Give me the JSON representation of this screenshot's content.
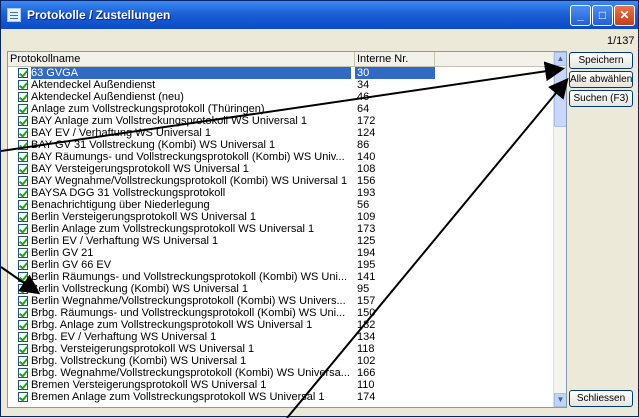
{
  "window": {
    "title": "Protokolle / Zustellungen",
    "counter": "1/137"
  },
  "columns": {
    "name": "Protokollname",
    "nr": "Interne Nr."
  },
  "rows": [
    {
      "name": "63 GVGA",
      "nr": "30",
      "selected": true
    },
    {
      "name": "Aktendeckel Außendienst",
      "nr": "34"
    },
    {
      "name": "Aktendeckel Außendienst (neu)",
      "nr": "46"
    },
    {
      "name": "Anlage zum Vollstreckungsprotokoll (Thüringen)",
      "nr": "64"
    },
    {
      "name": "BAY Anlage zum Vollstreckungsprotokoll WS Universal 1",
      "nr": "172"
    },
    {
      "name": "BAY EV / Verhaftung WS Universal 1",
      "nr": "124"
    },
    {
      "name": "BAY GV 31 Vollstreckung (Kombi) WS Universal 1",
      "nr": "86"
    },
    {
      "name": "BAY Räumungs- und Vollstreckungsprotokoll (Kombi) WS Univ...",
      "nr": "140"
    },
    {
      "name": "BAY Versteigerungsprotokoll WS Universal 1",
      "nr": "108"
    },
    {
      "name": "BAY Wegnahme/Vollstreckungsprotokoll (Kombi) WS Universal 1",
      "nr": "156"
    },
    {
      "name": "BAYSA DGG 31 Vollstreckungsprotokoll",
      "nr": "193"
    },
    {
      "name": "Benachrichtigung über Niederlegung",
      "nr": "56"
    },
    {
      "name": "Berlin  Versteigerungsprotokoll WS Universal 1",
      "nr": "109"
    },
    {
      "name": "Berlin Anlage zum Vollstreckungsprotokoll WS Universal 1",
      "nr": "173"
    },
    {
      "name": "Berlin EV / Verhaftung WS Universal 1",
      "nr": "125"
    },
    {
      "name": "Berlin GV 21",
      "nr": "194"
    },
    {
      "name": "Berlin GV 66 EV",
      "nr": "195"
    },
    {
      "name": "Berlin Räumungs- und Vollstreckungsprotokoll (Kombi) WS Uni...",
      "nr": "141"
    },
    {
      "name": "Berlin Vollstreckung (Kombi) WS Universal 1",
      "nr": "95"
    },
    {
      "name": "Berlin Wegnahme/Vollstreckungsprotokoll (Kombi) WS Univers...",
      "nr": "157"
    },
    {
      "name": "Brbg.  Räumungs- und Vollstreckungsprotokoll (Kombi) WS Uni...",
      "nr": "150"
    },
    {
      "name": "Brbg. Anlage zum Vollstreckungsprotokoll WS Universal 1",
      "nr": "182"
    },
    {
      "name": "Brbg. EV / Verhaftung WS Universal 1",
      "nr": "134"
    },
    {
      "name": "Brbg. Versteigerungsprotokoll WS Universal 1",
      "nr": "118"
    },
    {
      "name": "Brbg. Vollstreckung (Kombi) WS Universal 1",
      "nr": "102"
    },
    {
      "name": "Brbg. Wegnahme/Vollstreckungsprotokoll (Kombi) WS Universa...",
      "nr": "166"
    },
    {
      "name": "Bremen  Versteigerungsprotokoll WS Universal 1",
      "nr": "110"
    },
    {
      "name": "Bremen Anlage zum Vollstreckungsprotokoll WS Universal 1",
      "nr": "174"
    }
  ],
  "buttons": {
    "save": "Speichern",
    "deselect_all": "Alle abwählen",
    "search": "Suchen (F3)",
    "close": "Schliessen"
  },
  "scrollbar": {
    "up_icon": "▲",
    "down_icon": "▼"
  },
  "titlebar_buttons": {
    "minimize": "_",
    "maximize": "□",
    "close": "✕"
  }
}
